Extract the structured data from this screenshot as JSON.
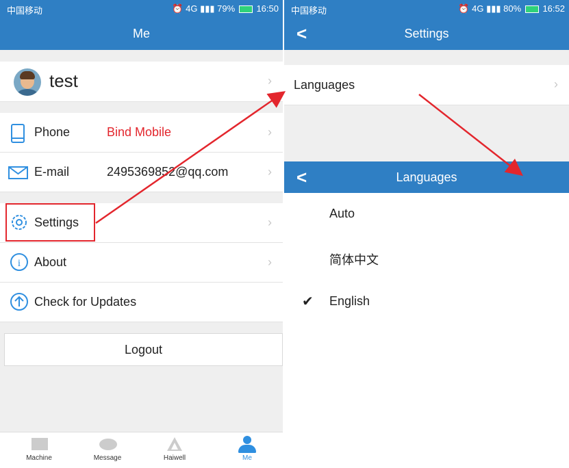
{
  "left": {
    "status": {
      "carrier": "中国移动",
      "net": "4G",
      "battery": "79%",
      "time": "16:50"
    },
    "title": "Me",
    "user": {
      "name": "test"
    },
    "rows": {
      "phone_label": "Phone",
      "phone_value": "Bind Mobile",
      "email_label": "E-mail",
      "email_value": "2495369852@qq.com",
      "settings_label": "Settings",
      "about_label": "About",
      "updates_label": "Check for Updates"
    },
    "logout_label": "Logout",
    "tabs": [
      {
        "label": "Machine",
        "icon": "machine-icon"
      },
      {
        "label": "Message",
        "icon": "message-icon"
      },
      {
        "label": "Haiwell",
        "icon": "haiwell-icon"
      },
      {
        "label": "Me",
        "icon": "person-icon"
      }
    ]
  },
  "right": {
    "status": {
      "carrier": "中国移动",
      "net": "4G",
      "battery": "80%",
      "time": "16:52"
    },
    "title": "Settings",
    "languages_row": "Languages",
    "languages_title": "Languages",
    "options": [
      {
        "label": "Auto",
        "selected": false
      },
      {
        "label": "简体中文",
        "selected": false
      },
      {
        "label": "English",
        "selected": true
      }
    ]
  },
  "colors": {
    "primary": "#2f7fc4",
    "accent_red": "#e3262d",
    "active_tab": "#2f8fe0"
  }
}
